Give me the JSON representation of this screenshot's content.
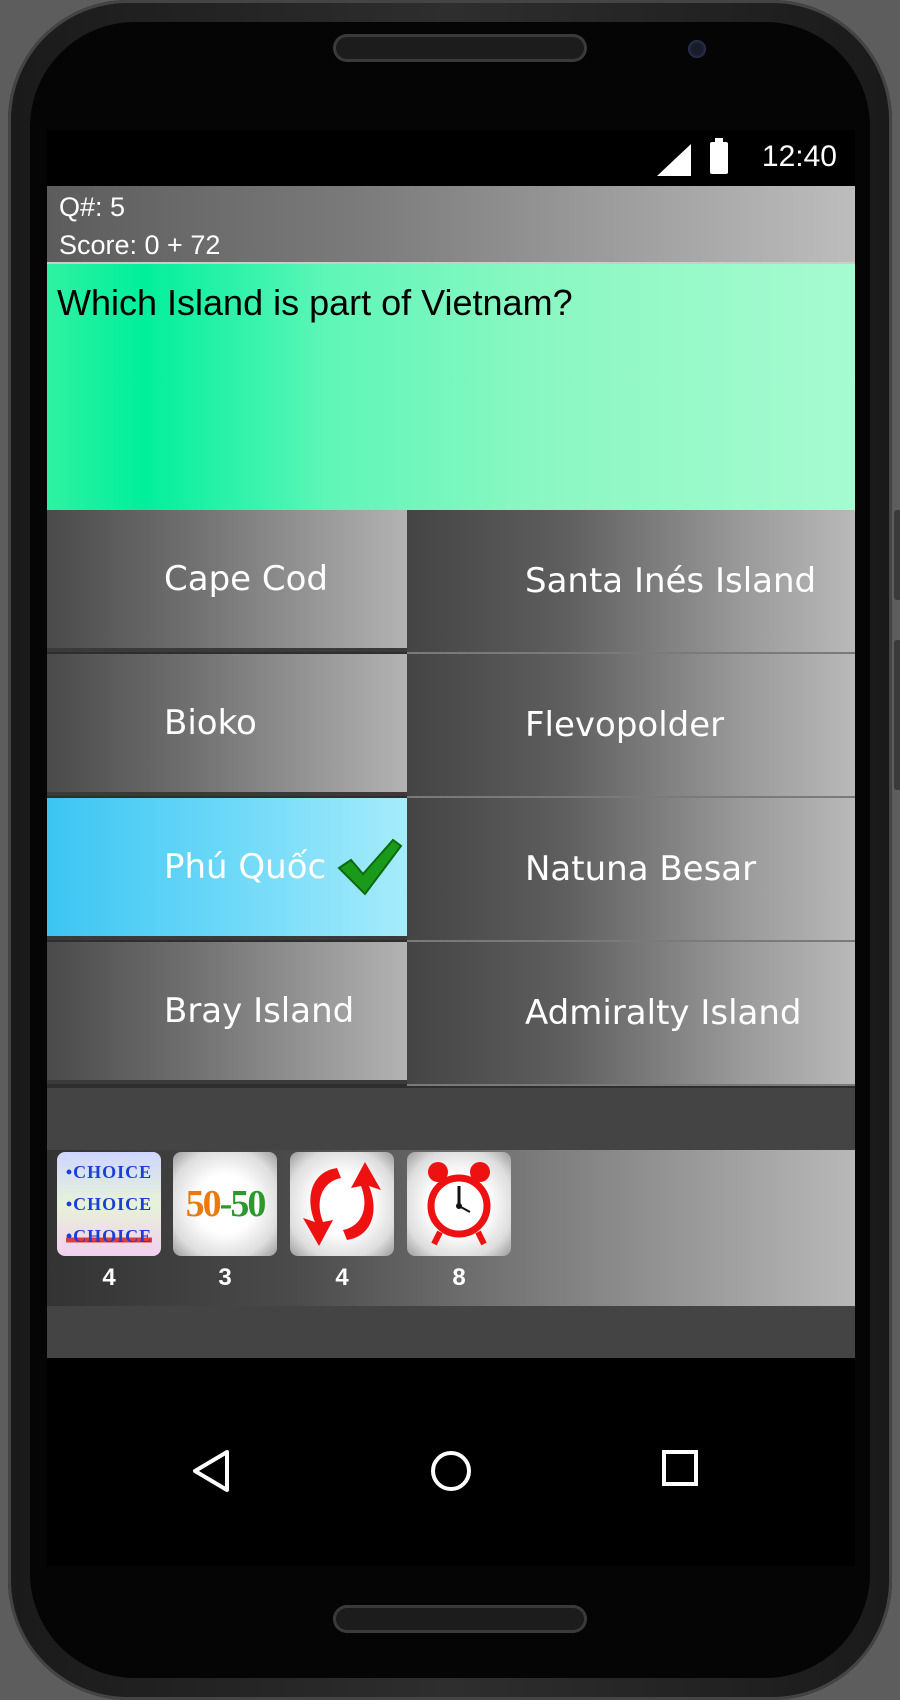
{
  "status_bar": {
    "time": "12:40"
  },
  "header": {
    "question_number": "Q#: 5",
    "score": "Score: 0 + 72"
  },
  "question": {
    "text": "Which Island is part of Vietnam?"
  },
  "answers": [
    {
      "label": "Cape Cod"
    },
    {
      "label": "Santa Inés Island"
    },
    {
      "label": "Bioko"
    },
    {
      "label": "Flevopolder"
    },
    {
      "label": "Phú Quốc"
    },
    {
      "label": "Natuna Besar"
    },
    {
      "label": "Bray Island"
    },
    {
      "label": "Admiralty Island"
    }
  ],
  "selected_answer": "Phú Quốc",
  "lifelines": [
    {
      "icon": "choice-icon",
      "text_lines": [
        "•CHOICE",
        "•CHOICE",
        "•CHOICE"
      ],
      "count": "4"
    },
    {
      "icon": "fifty-fifty-icon",
      "text": "50-50",
      "count": "3"
    },
    {
      "icon": "swap-arrows-icon",
      "count": "4"
    },
    {
      "icon": "alarm-clock-icon",
      "count": "8"
    }
  ],
  "nav": {
    "back": "back-icon",
    "home": "home-icon",
    "recents": "recents-icon"
  },
  "colors": {
    "question_bg": "#00ef9c",
    "selected_bg": "#3cc5f2",
    "check": "#1a9a1a"
  }
}
